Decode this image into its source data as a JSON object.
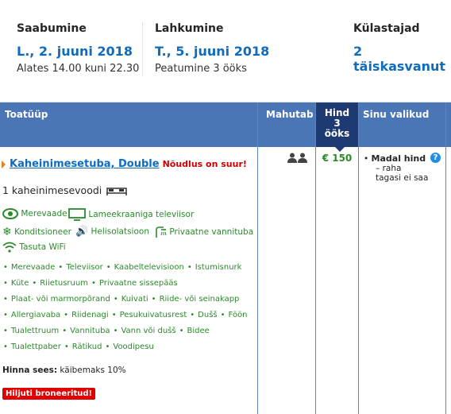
{
  "checkin": {
    "label": "Saabumine",
    "date": "L., 2. juuni 2018",
    "hours": "Alates 14.00 kuni 22.30"
  },
  "checkout": {
    "label": "Lahkumine",
    "date": "T., 5. juuni 2018",
    "stay": "Peatumine 3 ööks"
  },
  "guests": {
    "label": "Külastajad",
    "value": "2 täiskasvanut"
  },
  "table": {
    "col_room": "Toatüüp",
    "col_sleeps": "Mahutab",
    "col_price_l1": "Hind",
    "col_price_l2": "3",
    "col_price_l3": "ööks",
    "col_choices": "Sinu valikud"
  },
  "room": {
    "name": "Kaheinimesetuba, Double",
    "demand": "Nõudlus on suur!",
    "bed": "1 kaheinimesevoodi",
    "features": [
      "Merevaade",
      "Lameekraaniga televiisor",
      "Konditsioneer",
      "Helisolatsioon",
      "Privaatne vannituba",
      "Tasuta WiFi"
    ],
    "amenity_rows": [
      [
        "Merevaade",
        "Televiisor",
        "Kaabeltelevisioon",
        "Istumisnurk"
      ],
      [
        "Küte",
        "Riietusruum",
        "Privaatne sissepääs"
      ],
      [
        "Plaat- või marmorpõrand",
        "Kuivati",
        "Riide- või seinakapp"
      ],
      [
        "Allergiavaba",
        "Riidenagi",
        "Pesukuivatusrest",
        "Dušš",
        "Föön"
      ],
      [
        "Tualettruum",
        "Vannituba",
        "Vann või dušš",
        "Bidee"
      ],
      [
        "Tualettpaber",
        "Rätikud",
        "Voodipesu"
      ]
    ],
    "included_label": "Hinna sees:",
    "included_value": "käibemaks 10%",
    "badge": "Hiljuti broneeritud!",
    "price": "€ 150",
    "choice_title": "Madal hind",
    "choice_line1": "– raha",
    "choice_line2": "tagasi ei saa",
    "help": "?"
  },
  "colors": {
    "header_bg": "#4b76b5",
    "price_header_bg": "#1e3a73",
    "link": "#0f6cbd",
    "green": "#2a8a2a",
    "red": "#e00000"
  }
}
